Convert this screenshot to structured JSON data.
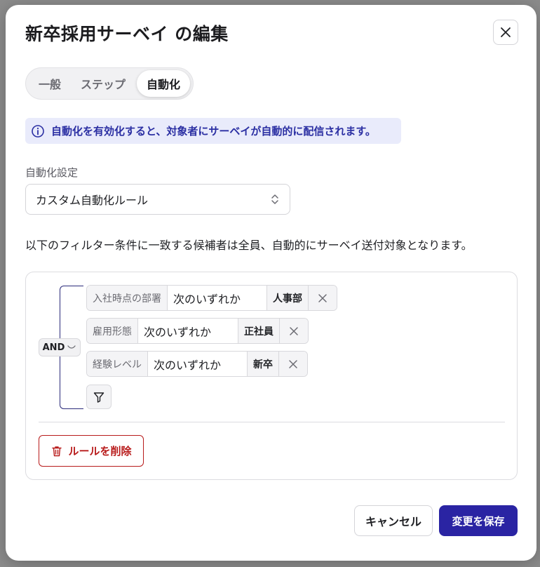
{
  "modal": {
    "title": "新卒採用サーベイ の編集"
  },
  "tabs": [
    {
      "label": "一般",
      "active": false
    },
    {
      "label": "ステップ",
      "active": false
    },
    {
      "label": "自動化",
      "active": true
    }
  ],
  "info_banner": {
    "icon": "info-icon",
    "text": "自動化を有効化すると、対象者にサーベイが自動的に配信されます。",
    "color": "#2b2fa3",
    "background": "#e9ebfb"
  },
  "automation_setting": {
    "label": "自動化設定",
    "selected": "カスタム自動化ルール"
  },
  "description": "以下のフィルター条件に一致する候補者は全員、自動的にサーベイ送付対象となります。",
  "rule": {
    "operator": "AND",
    "filters": [
      {
        "field": "入社時点の部署",
        "op": "次のいずれか",
        "value": "人事部"
      },
      {
        "field": "雇用形態",
        "op": "次のいずれか",
        "value": "正社員"
      },
      {
        "field": "経験レベル",
        "op": "次のいずれか",
        "value": "新卒"
      }
    ],
    "delete_label": "ルールを削除"
  },
  "footer": {
    "cancel_label": "キャンセル",
    "save_label": "変更を保存",
    "accent_color": "#2a24a3",
    "danger_color": "#b81b1b"
  }
}
